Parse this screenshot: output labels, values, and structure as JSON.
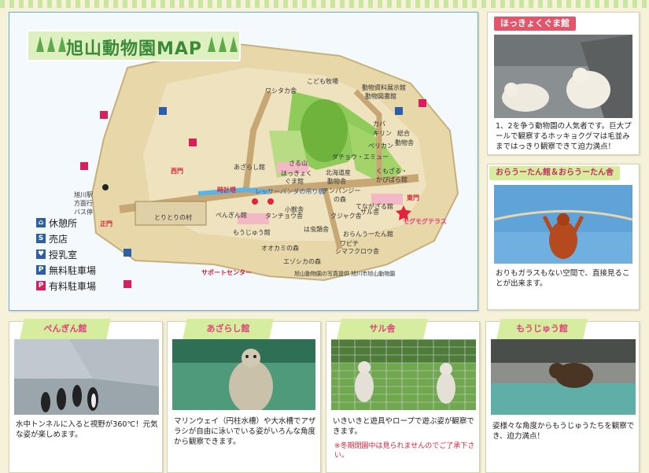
{
  "map": {
    "title": "旭山動物園MAP",
    "labels": {
      "kodomo": "こども牧場",
      "wanjiku": "ワシタカ舎",
      "shiryo": "動物資料展示館",
      "tosho": "動物図書館",
      "kaba": "カバ",
      "kirin": "キリン",
      "sogo": "総合",
      "sogo2": "動物舎",
      "pelican": "ペリカン",
      "giraffe_emu": "ダチョウ・エミュー",
      "kumogeza": "くもざる・",
      "capybara": "かぴばら館",
      "saru_yama": "さる山",
      "hokkyoku": "ほっきょく",
      "hokkyoku2": "ぐま館",
      "azarashi": "あざらし館",
      "hokkaido": "北海道産",
      "hokkaido2": "動物舎",
      "chimp": "チンパンジー",
      "chimp2": "の森",
      "lesser_panda": "レッサーパンダの吊り橋",
      "kozoo": "小獣舎",
      "tenagazaru": "てながざる館",
      "tokei": "時計塔",
      "nishimon": "西門",
      "tanchou": "タンチョウ舎",
      "kujaku": "クジャク舎",
      "saru_sha": "サル舎",
      "penguin": "ぺんぎん館",
      "higashimon": "東門",
      "mogumogu": "モグモグテラス",
      "torinomura": "とりとりの村",
      "mojuu": "もうじゅう館",
      "hachurui": "は虫類舎",
      "oran": "おらんう一たん館",
      "ookami": "オオカミの森",
      "wapichi": "ワピチ",
      "shimafukuro": "シマフクロウ舎",
      "ezoshika": "エゾシカの森",
      "seimon": "正門",
      "asahikawa1": "旭川駅",
      "asahikawa2": "方面行",
      "asahikawa3": "バス停",
      "support": "サポートセンター",
      "credit": "旭山動物園の写真提供 旭川市旭山動物園"
    },
    "legend": [
      {
        "icon": "rest-icon",
        "label": "休憩所"
      },
      {
        "icon": "shop-icon",
        "label": "売店"
      },
      {
        "icon": "nursing-icon",
        "label": "授乳室"
      },
      {
        "icon": "free-parking-icon",
        "label": "無料駐車場"
      },
      {
        "icon": "paid-parking-icon",
        "label": "有料駐車場"
      }
    ]
  },
  "side": [
    {
      "tag": "ほっきょくぐま館",
      "caption": "1、2を争う動物園の人気者です。巨大プールで観察するホッキョクグマは毛並みまではっきり観察できて迫力満点！"
    },
    {
      "tag": "おらうーたん館＆おらうーたん舎",
      "caption": "おりもガラスもない空間で、直接見ることが出来ます。"
    }
  ],
  "bottom": [
    {
      "tag": "ぺんぎん館",
      "caption": "水中トンネルに入ると視野が360℃！元気な姿が楽しめます。"
    },
    {
      "tag": "あざらし館",
      "caption": "マリンウェイ（円柱水槽）や大水槽でアザラシが自由に泳いでいる姿がいろんな角度から観察できます。"
    },
    {
      "tag": "サル舎",
      "caption": "いきいきと遊具やロープで遊ぶ姿が観察できます。",
      "note": "※冬期閉園中は見られませんのでご了承下さい。"
    },
    {
      "tag": "もうじゅう館",
      "caption": "姿様々な角度からもうじゅうたちを観察でき、迫力満点！"
    }
  ]
}
